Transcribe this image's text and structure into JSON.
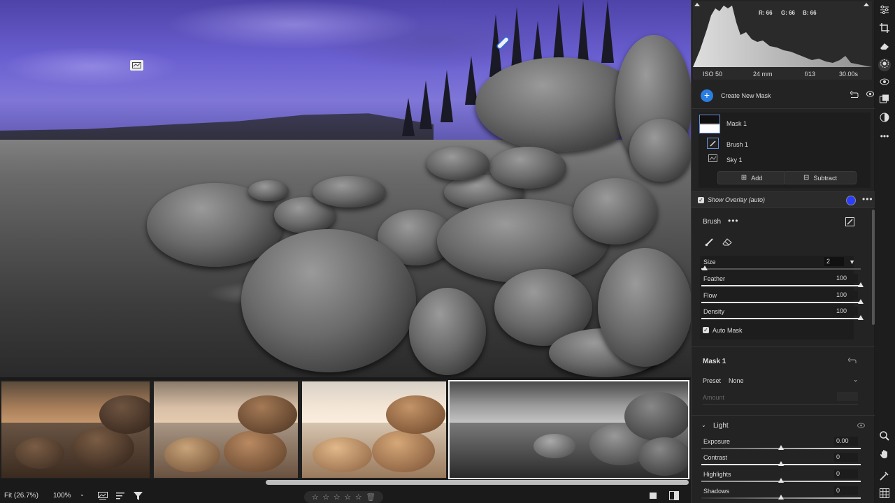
{
  "histogram": {
    "r": "R: 66",
    "g": "G: 66",
    "b": "B: 66"
  },
  "exif": {
    "iso": "ISO 50",
    "focal": "24 mm",
    "aperture": "f/13",
    "shutter": "30.00s"
  },
  "masks": {
    "create_label": "Create New Mask",
    "mask1_label": "Mask 1",
    "brush1_label": "Brush 1",
    "sky1_label": "Sky 1",
    "add_label": "Add",
    "subtract_label": "Subtract"
  },
  "overlay": {
    "label": "Show Overlay (auto)",
    "color": "#2a3cff"
  },
  "brush": {
    "title": "Brush",
    "size": {
      "label": "Size",
      "value": "2",
      "level": 0.02
    },
    "feather": {
      "label": "Feather",
      "value": "100",
      "level": 1.0
    },
    "flow": {
      "label": "Flow",
      "value": "100",
      "level": 1.0
    },
    "density": {
      "label": "Density",
      "value": "100",
      "level": 1.0
    },
    "auto_mask_label": "Auto Mask"
  },
  "mask1_section": {
    "title": "Mask 1",
    "preset_label": "Preset",
    "preset_value": "None",
    "amount_label": "Amount"
  },
  "light": {
    "title": "Light",
    "exposure": {
      "label": "Exposure",
      "value": "0.00",
      "level": 0.5
    },
    "contrast": {
      "label": "Contrast",
      "value": "0",
      "level": 0.5
    },
    "highlights": {
      "label": "Highlights",
      "value": "0",
      "level": 0.5
    },
    "shadows": {
      "label": "Shadows",
      "value": "0",
      "level": 0.5
    }
  },
  "bottombar": {
    "fit_label": "Fit (26.7%)",
    "zoom_label": "100%"
  },
  "colors": {
    "accent": "#2a7de1",
    "sky_mask": "#6a5fd0"
  }
}
